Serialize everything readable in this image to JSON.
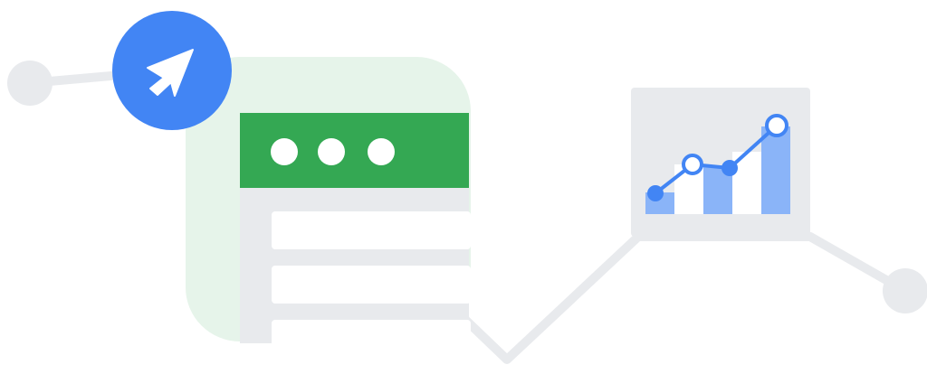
{
  "illustration": {
    "subject": "web-analytics-illustration",
    "colors": {
      "background": "#ffffff",
      "connector": "#e8eaed",
      "node": "#e8eaed",
      "accent_blue": "#4285f4",
      "bar_blue": "#8ab4f8",
      "green": "#34a853",
      "green_tint": "#e6f4ea",
      "window_body": "#e8eaed",
      "content_row": "#ffffff",
      "icon_white": "#ffffff"
    },
    "icons": {
      "cursor_badge": "cursor-arrow-icon",
      "window_dots": "more-horiz-icon",
      "chart_card": "bar-line-chart-icon"
    },
    "window": {
      "dot_count": 3,
      "content_row_count": 3
    }
  }
}
